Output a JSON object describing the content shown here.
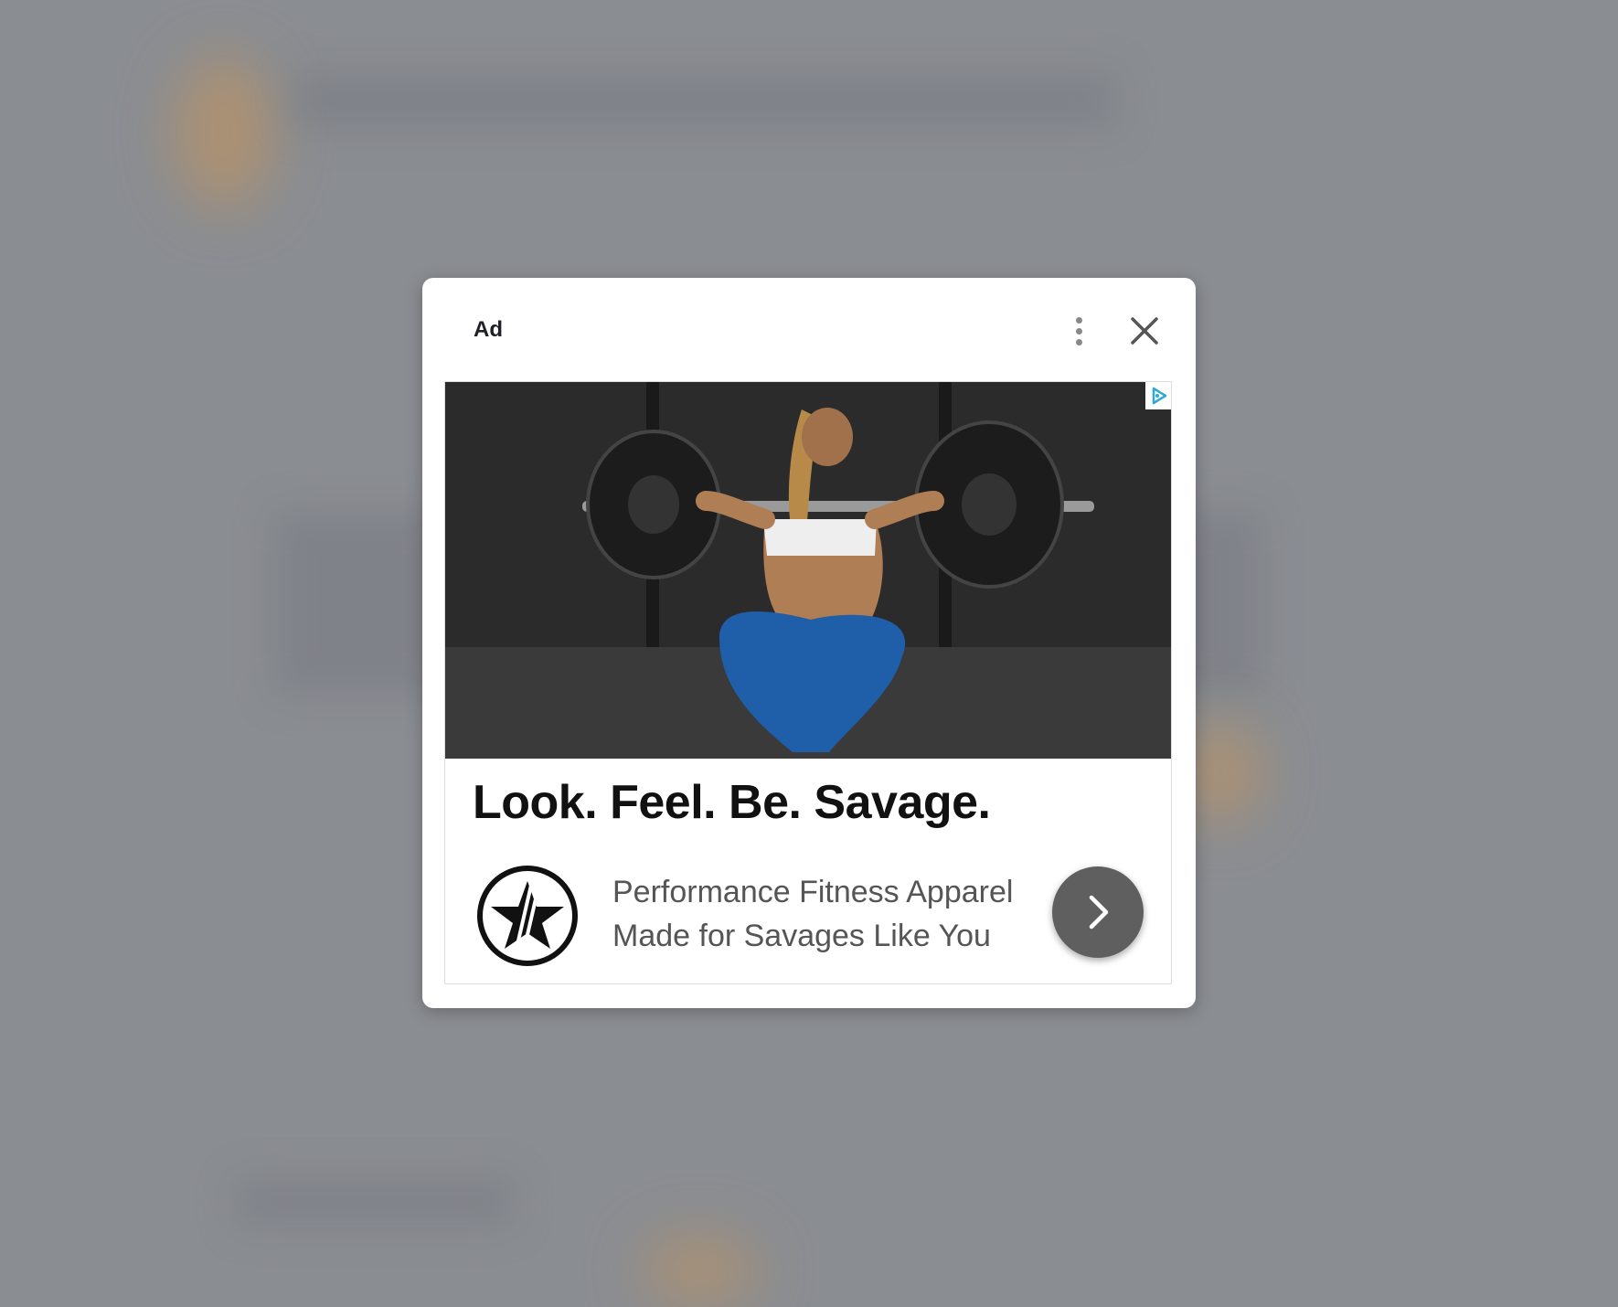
{
  "ad_modal": {
    "label": "Ad",
    "more_icon": "more-vertical-icon",
    "close_icon": "close-icon",
    "adchoices_icon": "adchoices-icon",
    "headline": "Look. Feel. Be. Savage.",
    "description": "Performance Fitness Apparel Made for Savages Like You",
    "cta_icon": "chevron-right-icon",
    "brand_logo_icon": "star-circle-logo-icon",
    "image_subject": "barbell-squat-photo"
  },
  "colors": {
    "overlay": "#8a8d92",
    "cta_button": "#5f5f5f",
    "adchoices": "#2ea8d6",
    "headline": "#111111",
    "description": "#555555"
  }
}
